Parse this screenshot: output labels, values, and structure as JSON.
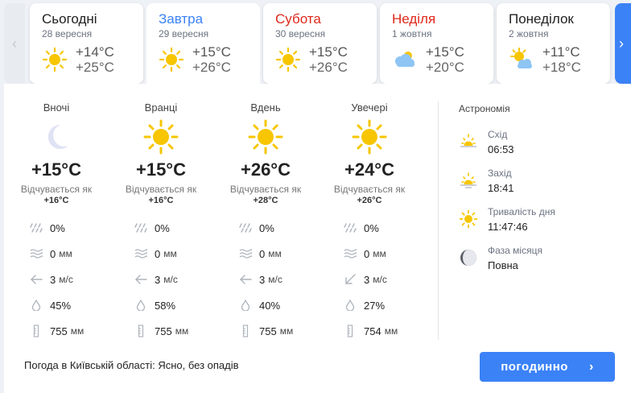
{
  "days": [
    {
      "name": "Сьогодні",
      "date": "28 вересня",
      "min": "+14°C",
      "max": "+25°C",
      "icon": "sun-icon",
      "color": "#222222"
    },
    {
      "name": "Завтра",
      "date": "29 вересня",
      "min": "+15°C",
      "max": "+26°C",
      "icon": "sun-icon",
      "color": "#3b82f6"
    },
    {
      "name": "Субота",
      "date": "30 вересня",
      "min": "+15°C",
      "max": "+26°C",
      "icon": "sun-icon",
      "color": "#e0281b"
    },
    {
      "name": "Неділя",
      "date": "1 жовтня",
      "min": "+15°C",
      "max": "+20°C",
      "icon": "cloud-sun-icon",
      "color": "#e0281b"
    },
    {
      "name": "Понеділок",
      "date": "2 жовтня",
      "min": "+11°C",
      "max": "+18°C",
      "icon": "sun-cloud-icon",
      "color": "#222222"
    }
  ],
  "periods": [
    {
      "label": "Вночі",
      "icon": "moon-icon",
      "temp": "+15°C",
      "feels_label": "Відчувається як",
      "feels": "+16°C",
      "precip": "0%",
      "rain": "0",
      "rain_unit": "мм",
      "wind": "3",
      "wind_unit": "м/с",
      "wind_dir": "west-arrow-icon",
      "humidity": "45%",
      "pressure": "755",
      "pressure_unit": "мм"
    },
    {
      "label": "Вранці",
      "icon": "sun-icon",
      "temp": "+15°C",
      "feels_label": "Відчувається як",
      "feels": "+16°C",
      "precip": "0%",
      "rain": "0",
      "rain_unit": "мм",
      "wind": "3",
      "wind_unit": "м/с",
      "wind_dir": "west-arrow-icon",
      "humidity": "58%",
      "pressure": "755",
      "pressure_unit": "мм"
    },
    {
      "label": "Вдень",
      "icon": "sun-icon",
      "temp": "+26°C",
      "feels_label": "Відчувається як",
      "feels": "+28°C",
      "precip": "0%",
      "rain": "0",
      "rain_unit": "мм",
      "wind": "3",
      "wind_unit": "м/с",
      "wind_dir": "west-arrow-icon",
      "humidity": "40%",
      "pressure": "755",
      "pressure_unit": "мм"
    },
    {
      "label": "Увечері",
      "icon": "sun-icon",
      "temp": "+24°C",
      "feels_label": "Відчувається як",
      "feels": "+26°C",
      "precip": "0%",
      "rain": "0",
      "rain_unit": "мм",
      "wind": "3",
      "wind_unit": "м/с",
      "wind_dir": "southwest-arrow-icon",
      "humidity": "27%",
      "pressure": "754",
      "pressure_unit": "мм"
    }
  ],
  "astronomy": {
    "title": "Астрономія",
    "sunrise_label": "Схід",
    "sunrise": "06:53",
    "sunset_label": "Захід",
    "sunset": "18:41",
    "daylength_label": "Тривалість дня",
    "daylength": "11:47:46",
    "moon_label": "Фаза місяця",
    "moon": "Повна"
  },
  "summary": "Погода в Київській області: Ясно, без опадів",
  "button_label": "погодинно",
  "colors": {
    "accent": "#3b82f6",
    "sun": "#f7c600",
    "weekend": "#e0281b"
  }
}
